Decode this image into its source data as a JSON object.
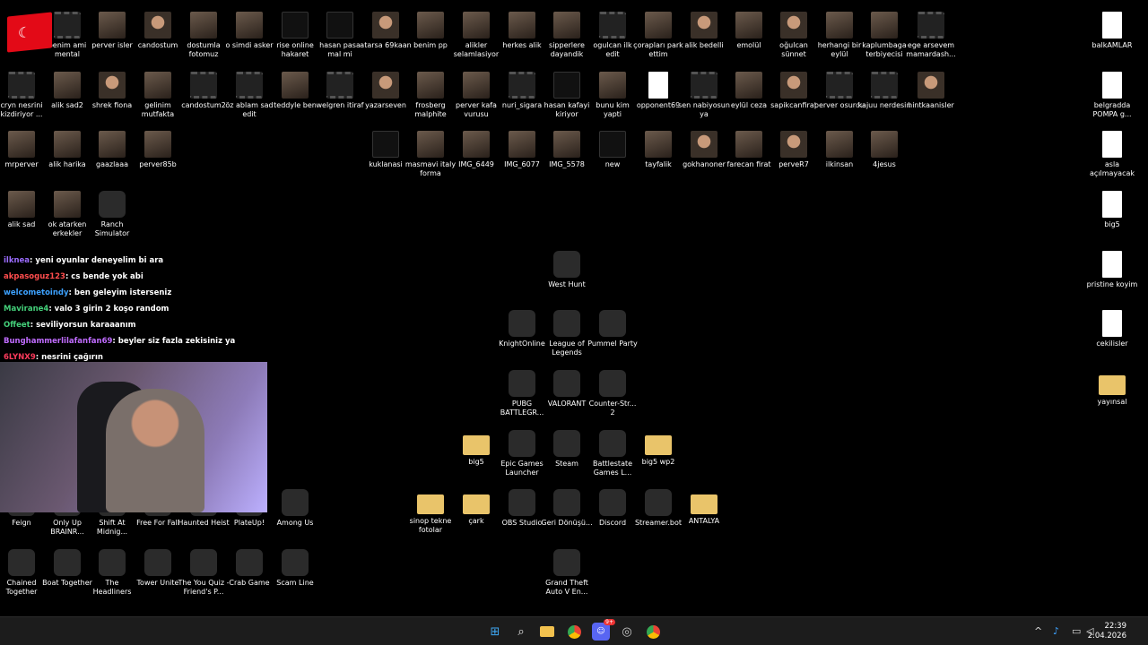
{
  "desktop": {
    "icons": [
      {
        "label": "benim ami mental",
        "kind": "video"
      },
      {
        "label": "perver isler",
        "kind": "photo"
      },
      {
        "label": "candostum",
        "kind": "face"
      },
      {
        "label": "dostumla fotomuz",
        "kind": "photo"
      },
      {
        "label": "o simdi asker",
        "kind": "photo"
      },
      {
        "label": "rise online hakaret",
        "kind": "dark"
      },
      {
        "label": "hasan pasa mal mi",
        "kind": "dark"
      },
      {
        "label": "atarsa 69kaan",
        "kind": "face"
      },
      {
        "label": "benim pp",
        "kind": "photo"
      },
      {
        "label": "alikler selamlasiyor",
        "kind": "photo"
      },
      {
        "label": "herkes alik",
        "kind": "photo"
      },
      {
        "label": "sipperlere dayandik",
        "kind": "photo"
      },
      {
        "label": "ogulcan ilk edit",
        "kind": "video"
      },
      {
        "label": "çorapları park ettim",
        "kind": "photo"
      },
      {
        "label": "alik bedelli",
        "kind": "face"
      },
      {
        "label": "emolül",
        "kind": "photo"
      },
      {
        "label": "oğulcan sünnet",
        "kind": "face"
      },
      {
        "label": "herhangi bir eylül",
        "kind": "photo"
      },
      {
        "label": "kaplumbaga terbiyecisi",
        "kind": "photo"
      },
      {
        "label": "ege arsevem mamardash...",
        "kind": "video"
      },
      {
        "label": "balkAMLAR",
        "kind": "doc"
      },
      {
        "label": "cryn nesrini kizdiriyor ...",
        "kind": "video"
      },
      {
        "label": "alik sad2",
        "kind": "photo"
      },
      {
        "label": "shrek fiona",
        "kind": "face"
      },
      {
        "label": "gelinim mutfakta",
        "kind": "photo"
      },
      {
        "label": "candostum2",
        "kind": "video"
      },
      {
        "label": "öz ablam sad edit",
        "kind": "video"
      },
      {
        "label": "teddyle ben",
        "kind": "photo"
      },
      {
        "label": "welgren itiraf",
        "kind": "video"
      },
      {
        "label": "yazarseven",
        "kind": "face"
      },
      {
        "label": "frosberg malphite",
        "kind": "photo"
      },
      {
        "label": "perver kafa vurusu",
        "kind": "photo"
      },
      {
        "label": "nuri_sigara",
        "kind": "video"
      },
      {
        "label": "hasan kafayi kiriyor",
        "kind": "dark"
      },
      {
        "label": "bunu kim yapti",
        "kind": "photo"
      },
      {
        "label": "opponent69",
        "kind": "doc"
      },
      {
        "label": "sen nabiyosun ya",
        "kind": "video"
      },
      {
        "label": "eylül ceza",
        "kind": "photo"
      },
      {
        "label": "sapikcanfirat",
        "kind": "face"
      },
      {
        "label": "perver osurdu",
        "kind": "video"
      },
      {
        "label": "kajuu nerdesin",
        "kind": "video"
      },
      {
        "label": "hintkaanisler",
        "kind": "face"
      },
      {
        "label": "belgradda POMPA g...",
        "kind": "doc"
      },
      {
        "label": "mrperver",
        "kind": "photo"
      },
      {
        "label": "alik harika",
        "kind": "photo"
      },
      {
        "label": "gaazlaaa",
        "kind": "photo"
      },
      {
        "label": "perver85b",
        "kind": "photo"
      },
      {
        "label": "kuklanasi",
        "kind": "dark"
      },
      {
        "label": "masmavi italy forma",
        "kind": "photo"
      },
      {
        "label": "IMG_6449",
        "kind": "photo"
      },
      {
        "label": "IMG_6077",
        "kind": "photo"
      },
      {
        "label": "IMG_5578",
        "kind": "photo"
      },
      {
        "label": "new",
        "kind": "dark"
      },
      {
        "label": "tayfalik",
        "kind": "photo"
      },
      {
        "label": "gokhanoner",
        "kind": "face"
      },
      {
        "label": "farecan firat",
        "kind": "photo"
      },
      {
        "label": "perveR7",
        "kind": "face"
      },
      {
        "label": "ilkinsan",
        "kind": "photo"
      },
      {
        "label": "4jesus",
        "kind": "photo"
      },
      {
        "label": "asla açılmayacak",
        "kind": "doc"
      },
      {
        "label": "alik sad",
        "kind": "photo"
      },
      {
        "label": "ok atarken erkekler",
        "kind": "photo"
      },
      {
        "label": "Ranch Simulator",
        "kind": "app"
      },
      {
        "label": "big5",
        "kind": "doc"
      },
      {
        "label": "West Hunt",
        "kind": "app"
      },
      {
        "label": "pristine koyim",
        "kind": "doc"
      },
      {
        "label": "KnightOnline",
        "kind": "app"
      },
      {
        "label": "League of Legends",
        "kind": "app"
      },
      {
        "label": "Pummel Party",
        "kind": "app"
      },
      {
        "label": "cekilisler",
        "kind": "doc"
      },
      {
        "label": "PUBG BATTLEGR...",
        "kind": "app"
      },
      {
        "label": "VALORANT",
        "kind": "app"
      },
      {
        "label": "Counter-Str... 2",
        "kind": "app"
      },
      {
        "label": "yayınsal",
        "kind": "folder"
      },
      {
        "label": "big5",
        "kind": "folder"
      },
      {
        "label": "Epic Games Launcher",
        "kind": "app"
      },
      {
        "label": "Steam",
        "kind": "app"
      },
      {
        "label": "Battlestate Games L...",
        "kind": "app"
      },
      {
        "label": "big5 wp2",
        "kind": "folder"
      },
      {
        "label": "sinop tekne fotolar",
        "kind": "folder"
      },
      {
        "label": "çark",
        "kind": "folder"
      },
      {
        "label": "OBS Studio",
        "kind": "app"
      },
      {
        "label": "Geri Dönüşü...",
        "kind": "app"
      },
      {
        "label": "Discord",
        "kind": "app"
      },
      {
        "label": "Streamer.bot",
        "kind": "app"
      },
      {
        "label": "ANTALYA",
        "kind": "folder"
      },
      {
        "label": "Feign",
        "kind": "app"
      },
      {
        "label": "Only Up BRAINR...",
        "kind": "app"
      },
      {
        "label": "Shift At Midnig...",
        "kind": "app"
      },
      {
        "label": "Free For Fall",
        "kind": "app"
      },
      {
        "label": "Haunted Heist",
        "kind": "app"
      },
      {
        "label": "PlateUp!",
        "kind": "app"
      },
      {
        "label": "Among Us",
        "kind": "app"
      },
      {
        "label": "Grand Theft Auto V En...",
        "kind": "app"
      },
      {
        "label": "Chained Together",
        "kind": "app"
      },
      {
        "label": "Boat Together",
        "kind": "app"
      },
      {
        "label": "The Headliners",
        "kind": "app"
      },
      {
        "label": "Tower Unite",
        "kind": "app"
      },
      {
        "label": "The You Quiz - Friend's P...",
        "kind": "app"
      },
      {
        "label": "Crab Game",
        "kind": "app"
      },
      {
        "label": "Scam Line",
        "kind": "app"
      }
    ]
  },
  "chat": [
    {
      "user": "ilknea",
      "text": ": yeni oyunlar deneyelim bi ara",
      "color": "#9b6cff"
    },
    {
      "user": "akpasoguz123",
      "text": ": cs bende yok abi",
      "color": "#ff4d4d"
    },
    {
      "user": "welcometoindy",
      "text": ": ben geleyim isterseniz",
      "color": "#3da2ff"
    },
    {
      "user": "Mavirane4",
      "text": ": valo 3 girin 2 koşo random",
      "color": "#44d17a"
    },
    {
      "user": "Offeet",
      "text": ": seviliyorsun karaaanım",
      "color": "#44d17a"
    },
    {
      "user": "Bunghammerlilafanfan69",
      "text": ": beyler siz fazla zekisiniz ya",
      "color": "#c06cff"
    },
    {
      "user": "6LYNX9",
      "text": ": nesrini çağırın",
      "color": "#ff3b5c"
    }
  ],
  "taskbar": {
    "pinned": [
      "start-icon",
      "search-icon",
      "file-explorer-icon",
      "chrome-icon",
      "discord-icon",
      "obs-icon",
      "chrome-icon"
    ],
    "discord_badge": "9+",
    "time": "22:39",
    "date": "2.04.2026"
  }
}
